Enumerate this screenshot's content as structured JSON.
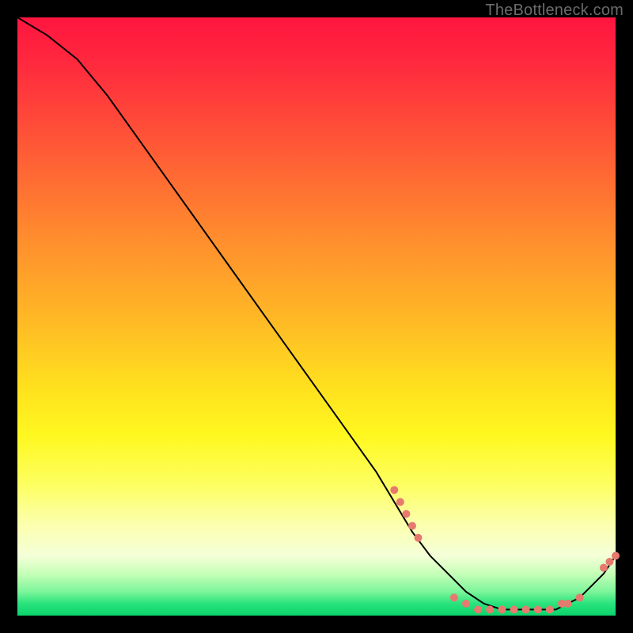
{
  "watermark": "TheBottleneck.com",
  "colors": {
    "frame": "#000000",
    "marker": "#e77a6f",
    "curve": "#000000"
  },
  "chart_data": {
    "type": "line",
    "title": "",
    "xlabel": "",
    "ylabel": "",
    "xlim": [
      0,
      100
    ],
    "ylim": [
      0,
      100
    ],
    "grid": false,
    "legend": false,
    "note": "Axes are unlabeled in the source image; x/y values below are estimated in chart-percentage units (0–100 on each axis).",
    "series": [
      {
        "name": "curve",
        "x": [
          0,
          5,
          10,
          15,
          20,
          25,
          30,
          35,
          40,
          45,
          50,
          55,
          60,
          63,
          66,
          69,
          72,
          75,
          78,
          81,
          84,
          87,
          90,
          92,
          94,
          96,
          98,
          100
        ],
        "y": [
          100,
          97,
          93,
          87,
          80,
          73,
          66,
          59,
          52,
          45,
          38,
          31,
          24,
          19,
          14,
          10,
          7,
          4,
          2,
          1,
          1,
          1,
          1,
          2,
          3,
          5,
          7,
          10
        ]
      }
    ],
    "markers": [
      {
        "x": 63,
        "y": 21
      },
      {
        "x": 64,
        "y": 19
      },
      {
        "x": 65,
        "y": 17
      },
      {
        "x": 66,
        "y": 15
      },
      {
        "x": 67,
        "y": 13
      },
      {
        "x": 73,
        "y": 3
      },
      {
        "x": 75,
        "y": 2
      },
      {
        "x": 77,
        "y": 1
      },
      {
        "x": 79,
        "y": 1
      },
      {
        "x": 81,
        "y": 1
      },
      {
        "x": 83,
        "y": 1
      },
      {
        "x": 85,
        "y": 1
      },
      {
        "x": 87,
        "y": 1
      },
      {
        "x": 89,
        "y": 1
      },
      {
        "x": 91,
        "y": 2
      },
      {
        "x": 92,
        "y": 2
      },
      {
        "x": 94,
        "y": 3
      },
      {
        "x": 98,
        "y": 8
      },
      {
        "x": 99,
        "y": 9
      },
      {
        "x": 100,
        "y": 10
      }
    ]
  }
}
